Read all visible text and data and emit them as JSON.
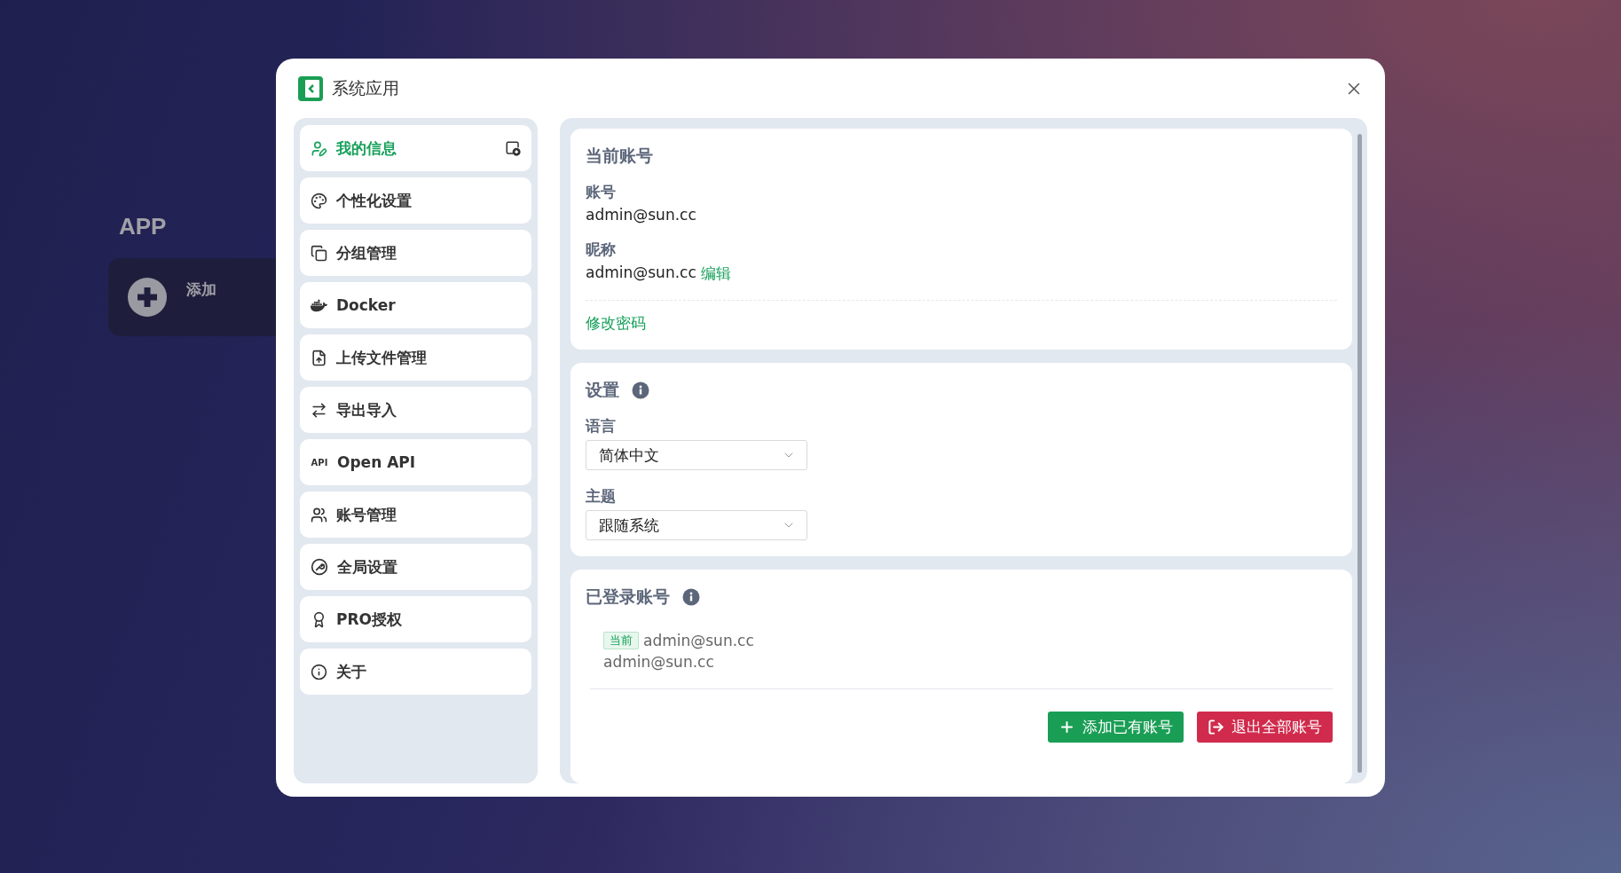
{
  "desktop": {
    "heading": "APP",
    "add_tile": {
      "label": "添加"
    }
  },
  "window": {
    "title": "系统应用"
  },
  "sidebar": {
    "items": [
      {
        "label": "我的信息",
        "selected": true
      },
      {
        "label": "个性化设置",
        "selected": false
      },
      {
        "label": "分组管理",
        "selected": false
      },
      {
        "label": "Docker",
        "selected": false
      },
      {
        "label": "上传文件管理",
        "selected": false
      },
      {
        "label": "导出导入",
        "selected": false
      },
      {
        "label": "Open API",
        "selected": false,
        "icon_text": "API"
      },
      {
        "label": "账号管理",
        "selected": false
      },
      {
        "label": "全局设置",
        "selected": false
      },
      {
        "label": "PRO授权",
        "selected": false
      },
      {
        "label": "关于",
        "selected": false
      }
    ]
  },
  "current_account": {
    "title": "当前账号",
    "fields": [
      {
        "label": "账号",
        "value": "admin@sun.cc"
      },
      {
        "label": "昵称",
        "value": "admin@sun.cc",
        "action": "编辑"
      }
    ],
    "link": "修改密码"
  },
  "settings": {
    "title": "设置",
    "fields": [
      {
        "label": "语言",
        "value": "简体中文"
      },
      {
        "label": "主题",
        "value": "跟随系统"
      }
    ]
  },
  "logged_in": {
    "title": "已登录账号",
    "accounts": [
      {
        "badge": "当前",
        "nickname": "admin@sun.cc",
        "username": "admin@sun.cc"
      }
    ],
    "buttons": [
      {
        "label": "添加已有账号",
        "kind": "primary"
      },
      {
        "label": "退出全部账号",
        "kind": "danger"
      }
    ]
  }
}
